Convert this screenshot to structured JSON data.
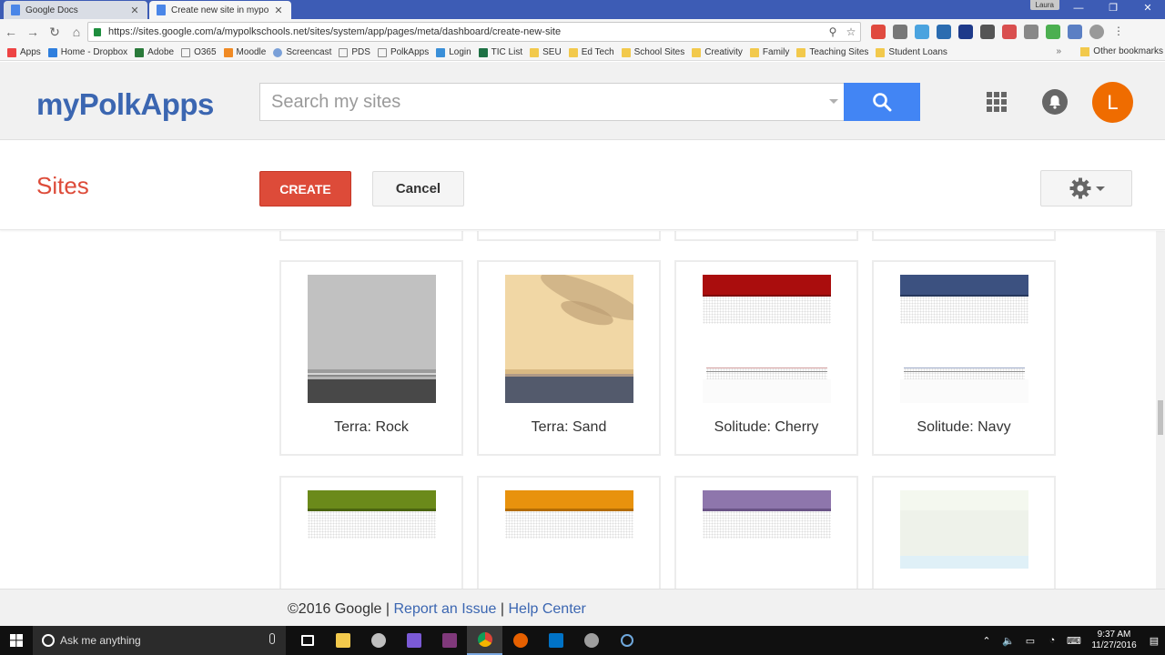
{
  "browser": {
    "tabs": [
      {
        "title": "Google Docs",
        "favicon_color": "#4a86e8"
      },
      {
        "title": "Create new site in mypo",
        "favicon_color": "#4a86e8"
      }
    ],
    "tab_close": "✕",
    "profile_name": "Laura",
    "window_controls": {
      "minimize": "—",
      "restore": "❐",
      "close": "✕"
    },
    "url": "https://sites.google.com/a/mypolkschools.net/sites/system/app/pages/meta/dashboard/create-new-site",
    "bookmarks": [
      "Apps",
      "Home - Dropbox",
      "Adobe",
      "O365",
      "Moodle",
      "Screencast",
      "PDS",
      "PolkApps",
      "Login",
      "TIC List",
      "SEU",
      "Ed Tech",
      "School Sites",
      "Creativity",
      "Family",
      "Teaching Sites",
      "Student Loans"
    ],
    "bookmark_more": "»",
    "other_bookmarks": "Other bookmarks"
  },
  "header": {
    "logo": "myPolkApps",
    "search_placeholder": "Search my sites",
    "avatar_letter": "L"
  },
  "subheader": {
    "title": "Sites",
    "create_label": "CREATE",
    "cancel_label": "Cancel"
  },
  "themes": [
    {
      "name": "Terra: Rock",
      "style": "rock"
    },
    {
      "name": "Terra: Sand",
      "style": "sand"
    },
    {
      "name": "Solitude: Cherry",
      "style": "solitude",
      "color": "#aa0d0d"
    },
    {
      "name": "Solitude: Navy",
      "style": "solitude",
      "color": "#3c5180"
    },
    {
      "name": "",
      "style": "solitude",
      "color": "#6b8a1a"
    },
    {
      "name": "",
      "style": "solitude",
      "color": "#e8920d"
    },
    {
      "name": "",
      "style": "solitude",
      "color": "#8e76ac"
    },
    {
      "name": "",
      "style": "pale"
    }
  ],
  "footer": {
    "copyright": "©2016 Google",
    "separator": "|",
    "report": "Report an Issue",
    "help": "Help Center"
  },
  "taskbar": {
    "search_placeholder": "Ask me anything",
    "time": "9:37 AM",
    "date": "11/27/2016"
  }
}
